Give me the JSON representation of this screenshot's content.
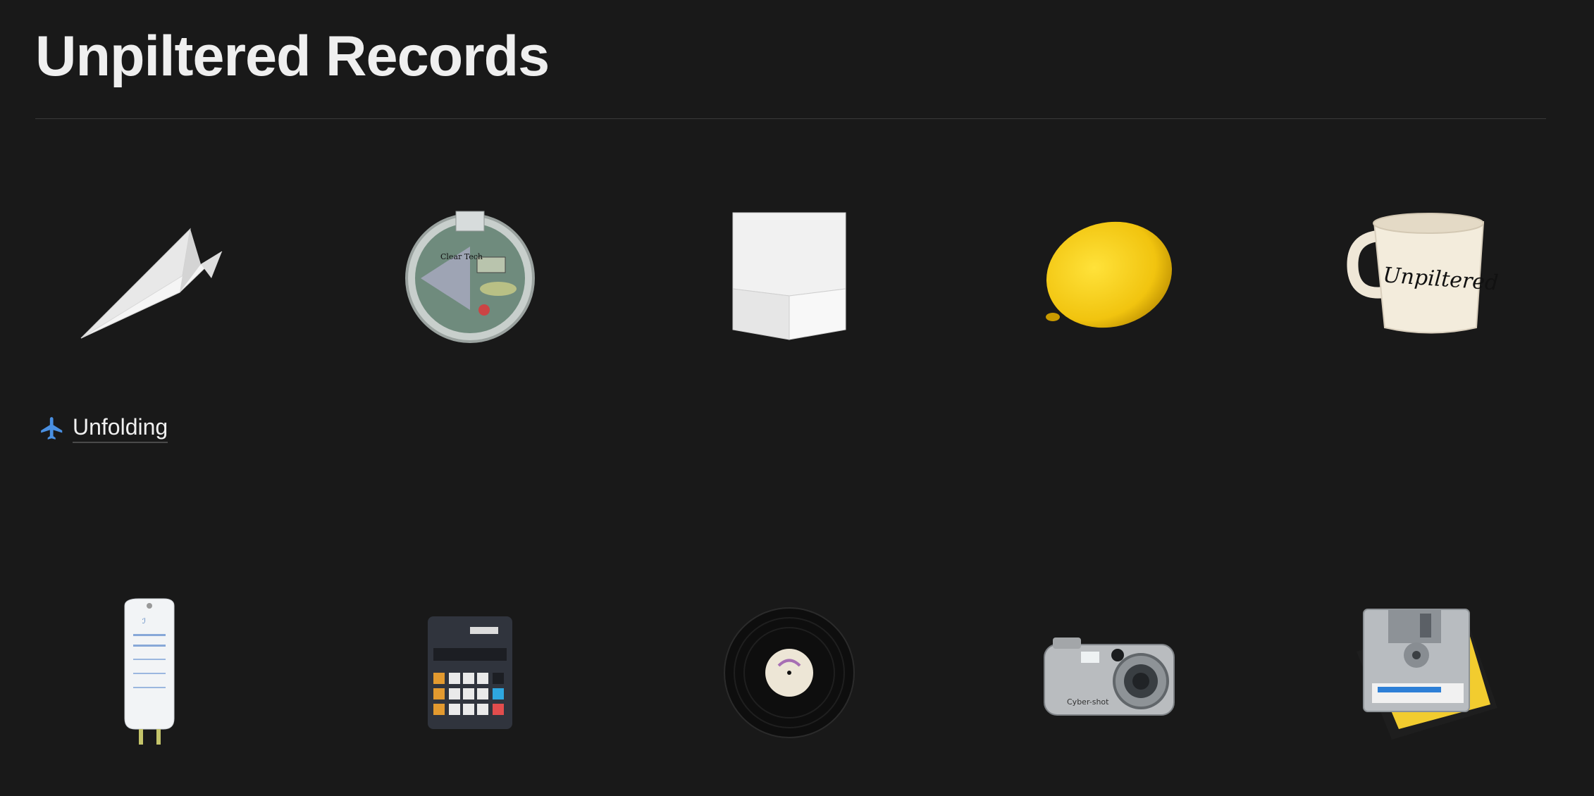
{
  "page": {
    "title": "Unpiltered Records"
  },
  "section": {
    "label": "Unfolding",
    "icon": "airplane-icon",
    "icon_color": "#4a90e2"
  },
  "gallery_row_1": [
    {
      "name": "paper-airplane",
      "icon": "paper-airplane-image"
    },
    {
      "name": "clear-device",
      "icon": "clear-device-image",
      "text": "Clear Tech"
    },
    {
      "name": "white-box",
      "icon": "white-box-image"
    },
    {
      "name": "lemon",
      "icon": "lemon-image"
    },
    {
      "name": "mug",
      "icon": "mug-image",
      "text": "Unpiltered"
    }
  ],
  "gallery_row_2": [
    {
      "name": "iv-bag",
      "icon": "iv-bag-image"
    },
    {
      "name": "calculator",
      "icon": "calculator-image"
    },
    {
      "name": "vinyl-record",
      "icon": "vinyl-record-image"
    },
    {
      "name": "digital-camera",
      "icon": "digital-camera-image",
      "text": "Cyber-shot"
    },
    {
      "name": "floppy-disks",
      "icon": "floppy-disks-image"
    }
  ],
  "colors": {
    "background": "#191919",
    "text": "#ededed",
    "divider": "#3a3a3a",
    "accent": "#4a90e2"
  }
}
